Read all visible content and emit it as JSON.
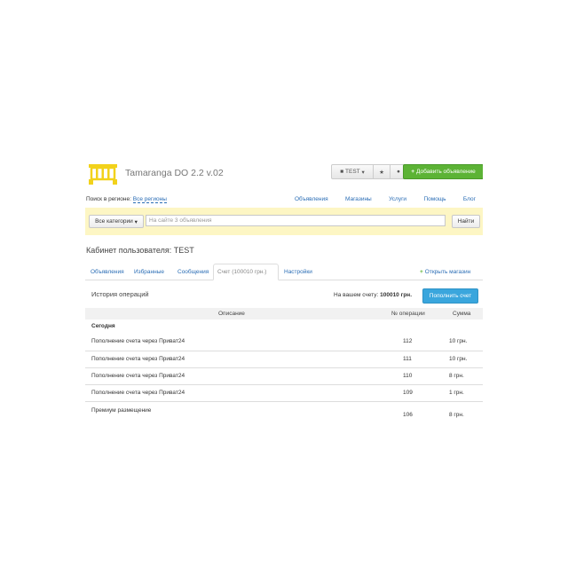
{
  "header": {
    "brand": "Tamaranga DO 2.2 v.02",
    "user_label": "TEST",
    "add_button": "Добавить объявление"
  },
  "region": {
    "label": "Поиск в регионе:",
    "link": "Все регионы"
  },
  "nav": [
    "Объявления",
    "Магазины",
    "Услуги",
    "Помощь",
    "Блог"
  ],
  "search": {
    "category_button": "Все категории",
    "placeholder": "На сайте 3 объявления",
    "find_button": "Найти"
  },
  "cabinet_title": "Кабинет пользователя: TEST",
  "tabs": [
    "Объявления",
    "Избранные",
    "Сообщения",
    "Счет (100010 грн.)",
    "Настройки"
  ],
  "open_shop": "Открыть магазин",
  "history": {
    "title": "История операций",
    "balance_label": "На вашем счету:",
    "balance_value": "100010 грн.",
    "topup_button": "Пополнить счет"
  },
  "table": {
    "headers": {
      "description": "Описание",
      "number": "№ операции",
      "amount": "Сумма"
    },
    "group": "Сегодня",
    "rows": [
      {
        "description": "Пополнение счета через Приват24",
        "number": "112",
        "amount": "10 грн."
      },
      {
        "description": "Пополнение счета через Приват24",
        "number": "111",
        "amount": "10 грн."
      },
      {
        "description": "Пополнение счета через Приват24",
        "number": "110",
        "amount": "8 грн."
      },
      {
        "description": "Пополнение счета через Приват24",
        "number": "109",
        "amount": "1 грн."
      },
      {
        "description": "Премиум размещение",
        "number": "106",
        "amount": "8 грн."
      }
    ]
  },
  "colors": {
    "green": "#5cb335",
    "blue": "#3aa6dd",
    "yellow_bar": "#fdf6c4",
    "logo": "#f2d21b",
    "link": "#2a6db5"
  },
  "icons": [
    "logo-icon",
    "user-icon",
    "caret-down-icon",
    "star-icon",
    "chat-icon",
    "plus-icon"
  ]
}
